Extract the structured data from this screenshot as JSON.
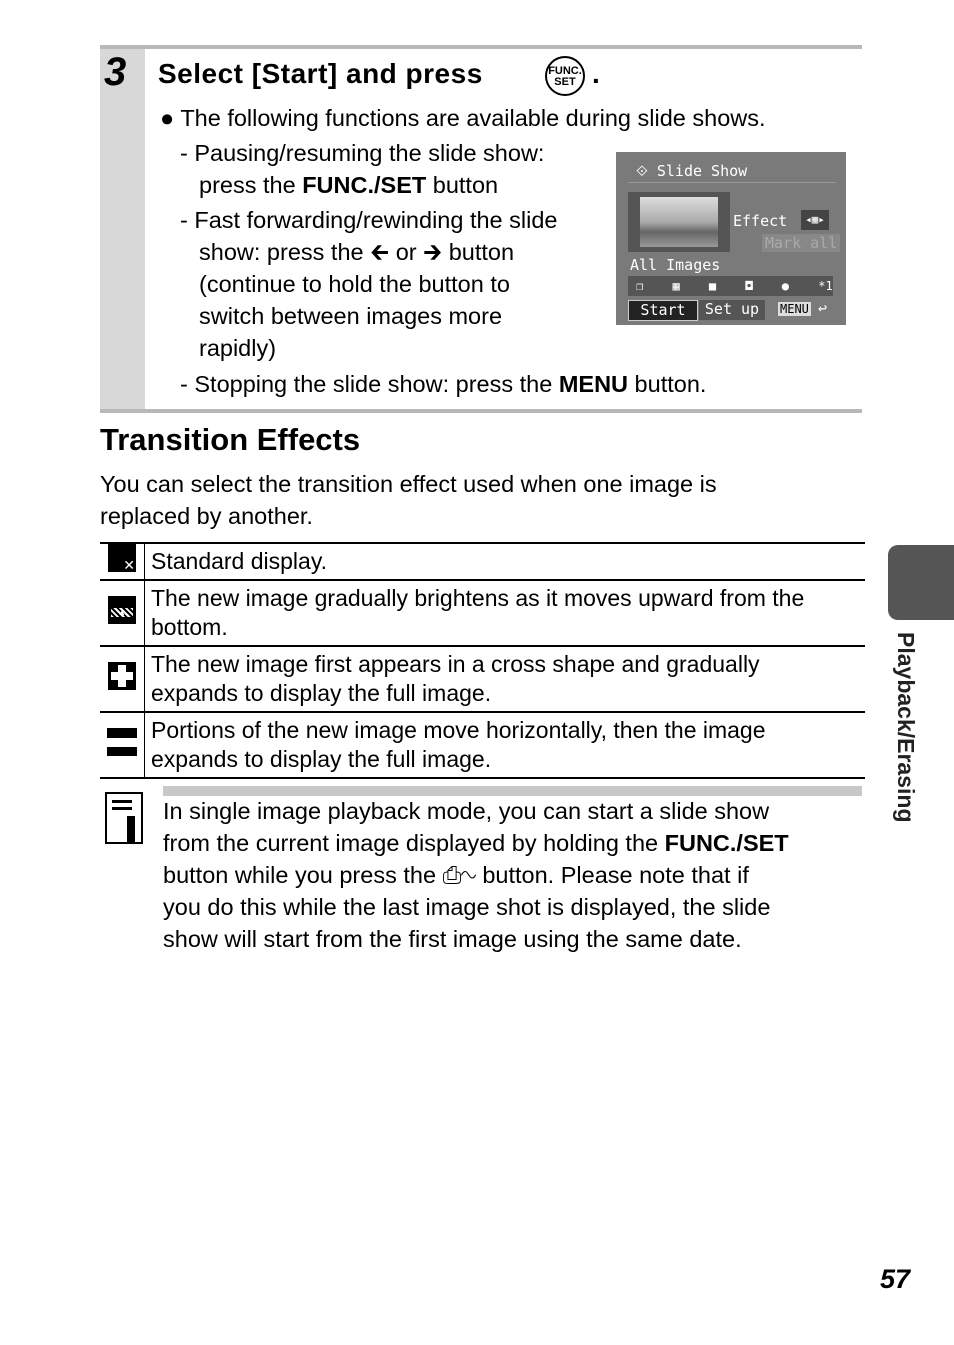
{
  "step": {
    "number": "3",
    "title": "Select [Start] and press",
    "title_end": ".",
    "func_icon": "FUNC.SET-button-icon",
    "bullet": "The following functions are available during slide shows.",
    "items": [
      {
        "dash": "-",
        "lines": [
          "Pausing/resuming the slide show:"
        ],
        "line2_pre": "press the ",
        "line2_bold": "FUNC./SET",
        "line2_post": " button"
      },
      {
        "dash": "-",
        "line1": "Fast forwarding/rewinding the slide",
        "line2_pre": "show: press the",
        "or": "or",
        "line2_post": "button",
        "line3": "(continue to hold the button to",
        "line4": "switch between images more",
        "line5": "rapidly)"
      },
      {
        "dash": "-",
        "pre": "Stopping the slide show: press the ",
        "bold": "MENU",
        "post": " button."
      }
    ]
  },
  "lcd": {
    "title": "Slide Show",
    "effect": "Effect",
    "mark_all": "Mark all",
    "all_images": "All Images",
    "count": "*1",
    "start": "Start",
    "setup": "Set up",
    "menu": "MENU"
  },
  "section": {
    "title": "Transition Effects",
    "intro1": "You can select the transition effect used when one image is",
    "intro2": "replaced by another."
  },
  "effects": [
    {
      "icon": "standard-display-icon",
      "text": [
        "Standard display."
      ]
    },
    {
      "icon": "brighten-upward-icon",
      "text": [
        "The new image gradually brightens as it moves upward from the",
        "bottom."
      ]
    },
    {
      "icon": "cross-shape-icon",
      "text": [
        "The new image first appears in a cross shape and gradually",
        "expands to display the full image."
      ]
    },
    {
      "icon": "horizontal-bar-icon",
      "text": [
        "Portions of the new image move horizontally, then the image",
        "expands to display the full image."
      ]
    }
  ],
  "note": {
    "l1": "In single image playback mode, you can start a slide show",
    "l2_pre": "from the current image displayed by holding the ",
    "l2_bold": "FUNC./SET",
    "l3_pre": "button while you press the",
    "l3_post": "button. Please note that if",
    "l4": "you do this while the last image shot is displayed, the slide",
    "l5": "show will start from the first image using the same date."
  },
  "side_tab": "Playback/Erasing",
  "page_number": "57"
}
